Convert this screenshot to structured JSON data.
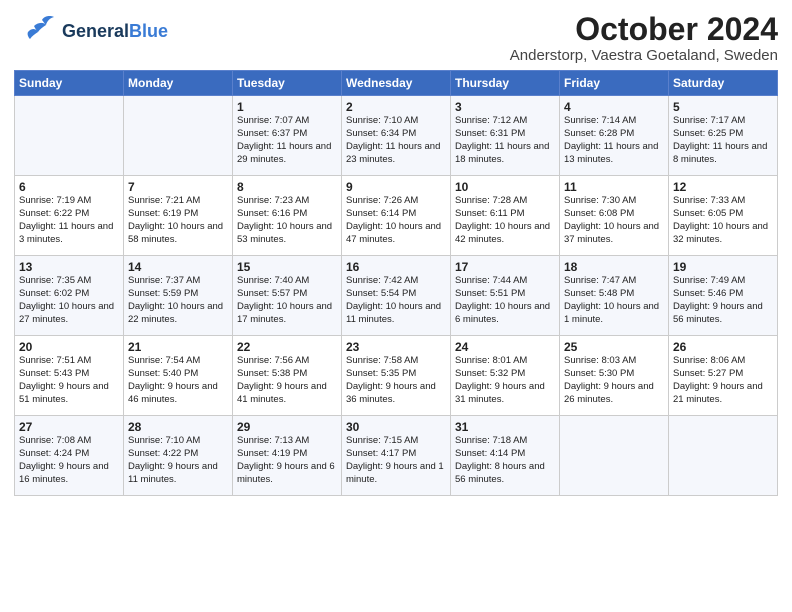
{
  "header": {
    "logo_general": "General",
    "logo_blue": "Blue",
    "title": "October 2024",
    "subtitle": "Anderstorp, Vaestra Goetaland, Sweden"
  },
  "weekdays": [
    "Sunday",
    "Monday",
    "Tuesday",
    "Wednesday",
    "Thursday",
    "Friday",
    "Saturday"
  ],
  "weeks": [
    [
      {
        "day": "",
        "sunrise": "",
        "sunset": "",
        "daylight": ""
      },
      {
        "day": "",
        "sunrise": "",
        "sunset": "",
        "daylight": ""
      },
      {
        "day": "1",
        "sunrise": "Sunrise: 7:07 AM",
        "sunset": "Sunset: 6:37 PM",
        "daylight": "Daylight: 11 hours and 29 minutes."
      },
      {
        "day": "2",
        "sunrise": "Sunrise: 7:10 AM",
        "sunset": "Sunset: 6:34 PM",
        "daylight": "Daylight: 11 hours and 23 minutes."
      },
      {
        "day": "3",
        "sunrise": "Sunrise: 7:12 AM",
        "sunset": "Sunset: 6:31 PM",
        "daylight": "Daylight: 11 hours and 18 minutes."
      },
      {
        "day": "4",
        "sunrise": "Sunrise: 7:14 AM",
        "sunset": "Sunset: 6:28 PM",
        "daylight": "Daylight: 11 hours and 13 minutes."
      },
      {
        "day": "5",
        "sunrise": "Sunrise: 7:17 AM",
        "sunset": "Sunset: 6:25 PM",
        "daylight": "Daylight: 11 hours and 8 minutes."
      }
    ],
    [
      {
        "day": "6",
        "sunrise": "Sunrise: 7:19 AM",
        "sunset": "Sunset: 6:22 PM",
        "daylight": "Daylight: 11 hours and 3 minutes."
      },
      {
        "day": "7",
        "sunrise": "Sunrise: 7:21 AM",
        "sunset": "Sunset: 6:19 PM",
        "daylight": "Daylight: 10 hours and 58 minutes."
      },
      {
        "day": "8",
        "sunrise": "Sunrise: 7:23 AM",
        "sunset": "Sunset: 6:16 PM",
        "daylight": "Daylight: 10 hours and 53 minutes."
      },
      {
        "day": "9",
        "sunrise": "Sunrise: 7:26 AM",
        "sunset": "Sunset: 6:14 PM",
        "daylight": "Daylight: 10 hours and 47 minutes."
      },
      {
        "day": "10",
        "sunrise": "Sunrise: 7:28 AM",
        "sunset": "Sunset: 6:11 PM",
        "daylight": "Daylight: 10 hours and 42 minutes."
      },
      {
        "day": "11",
        "sunrise": "Sunrise: 7:30 AM",
        "sunset": "Sunset: 6:08 PM",
        "daylight": "Daylight: 10 hours and 37 minutes."
      },
      {
        "day": "12",
        "sunrise": "Sunrise: 7:33 AM",
        "sunset": "Sunset: 6:05 PM",
        "daylight": "Daylight: 10 hours and 32 minutes."
      }
    ],
    [
      {
        "day": "13",
        "sunrise": "Sunrise: 7:35 AM",
        "sunset": "Sunset: 6:02 PM",
        "daylight": "Daylight: 10 hours and 27 minutes."
      },
      {
        "day": "14",
        "sunrise": "Sunrise: 7:37 AM",
        "sunset": "Sunset: 5:59 PM",
        "daylight": "Daylight: 10 hours and 22 minutes."
      },
      {
        "day": "15",
        "sunrise": "Sunrise: 7:40 AM",
        "sunset": "Sunset: 5:57 PM",
        "daylight": "Daylight: 10 hours and 17 minutes."
      },
      {
        "day": "16",
        "sunrise": "Sunrise: 7:42 AM",
        "sunset": "Sunset: 5:54 PM",
        "daylight": "Daylight: 10 hours and 11 minutes."
      },
      {
        "day": "17",
        "sunrise": "Sunrise: 7:44 AM",
        "sunset": "Sunset: 5:51 PM",
        "daylight": "Daylight: 10 hours and 6 minutes."
      },
      {
        "day": "18",
        "sunrise": "Sunrise: 7:47 AM",
        "sunset": "Sunset: 5:48 PM",
        "daylight": "Daylight: 10 hours and 1 minute."
      },
      {
        "day": "19",
        "sunrise": "Sunrise: 7:49 AM",
        "sunset": "Sunset: 5:46 PM",
        "daylight": "Daylight: 9 hours and 56 minutes."
      }
    ],
    [
      {
        "day": "20",
        "sunrise": "Sunrise: 7:51 AM",
        "sunset": "Sunset: 5:43 PM",
        "daylight": "Daylight: 9 hours and 51 minutes."
      },
      {
        "day": "21",
        "sunrise": "Sunrise: 7:54 AM",
        "sunset": "Sunset: 5:40 PM",
        "daylight": "Daylight: 9 hours and 46 minutes."
      },
      {
        "day": "22",
        "sunrise": "Sunrise: 7:56 AM",
        "sunset": "Sunset: 5:38 PM",
        "daylight": "Daylight: 9 hours and 41 minutes."
      },
      {
        "day": "23",
        "sunrise": "Sunrise: 7:58 AM",
        "sunset": "Sunset: 5:35 PM",
        "daylight": "Daylight: 9 hours and 36 minutes."
      },
      {
        "day": "24",
        "sunrise": "Sunrise: 8:01 AM",
        "sunset": "Sunset: 5:32 PM",
        "daylight": "Daylight: 9 hours and 31 minutes."
      },
      {
        "day": "25",
        "sunrise": "Sunrise: 8:03 AM",
        "sunset": "Sunset: 5:30 PM",
        "daylight": "Daylight: 9 hours and 26 minutes."
      },
      {
        "day": "26",
        "sunrise": "Sunrise: 8:06 AM",
        "sunset": "Sunset: 5:27 PM",
        "daylight": "Daylight: 9 hours and 21 minutes."
      }
    ],
    [
      {
        "day": "27",
        "sunrise": "Sunrise: 7:08 AM",
        "sunset": "Sunset: 4:24 PM",
        "daylight": "Daylight: 9 hours and 16 minutes."
      },
      {
        "day": "28",
        "sunrise": "Sunrise: 7:10 AM",
        "sunset": "Sunset: 4:22 PM",
        "daylight": "Daylight: 9 hours and 11 minutes."
      },
      {
        "day": "29",
        "sunrise": "Sunrise: 7:13 AM",
        "sunset": "Sunset: 4:19 PM",
        "daylight": "Daylight: 9 hours and 6 minutes."
      },
      {
        "day": "30",
        "sunrise": "Sunrise: 7:15 AM",
        "sunset": "Sunset: 4:17 PM",
        "daylight": "Daylight: 9 hours and 1 minute."
      },
      {
        "day": "31",
        "sunrise": "Sunrise: 7:18 AM",
        "sunset": "Sunset: 4:14 PM",
        "daylight": "Daylight: 8 hours and 56 minutes."
      },
      {
        "day": "",
        "sunrise": "",
        "sunset": "",
        "daylight": ""
      },
      {
        "day": "",
        "sunrise": "",
        "sunset": "",
        "daylight": ""
      }
    ]
  ]
}
